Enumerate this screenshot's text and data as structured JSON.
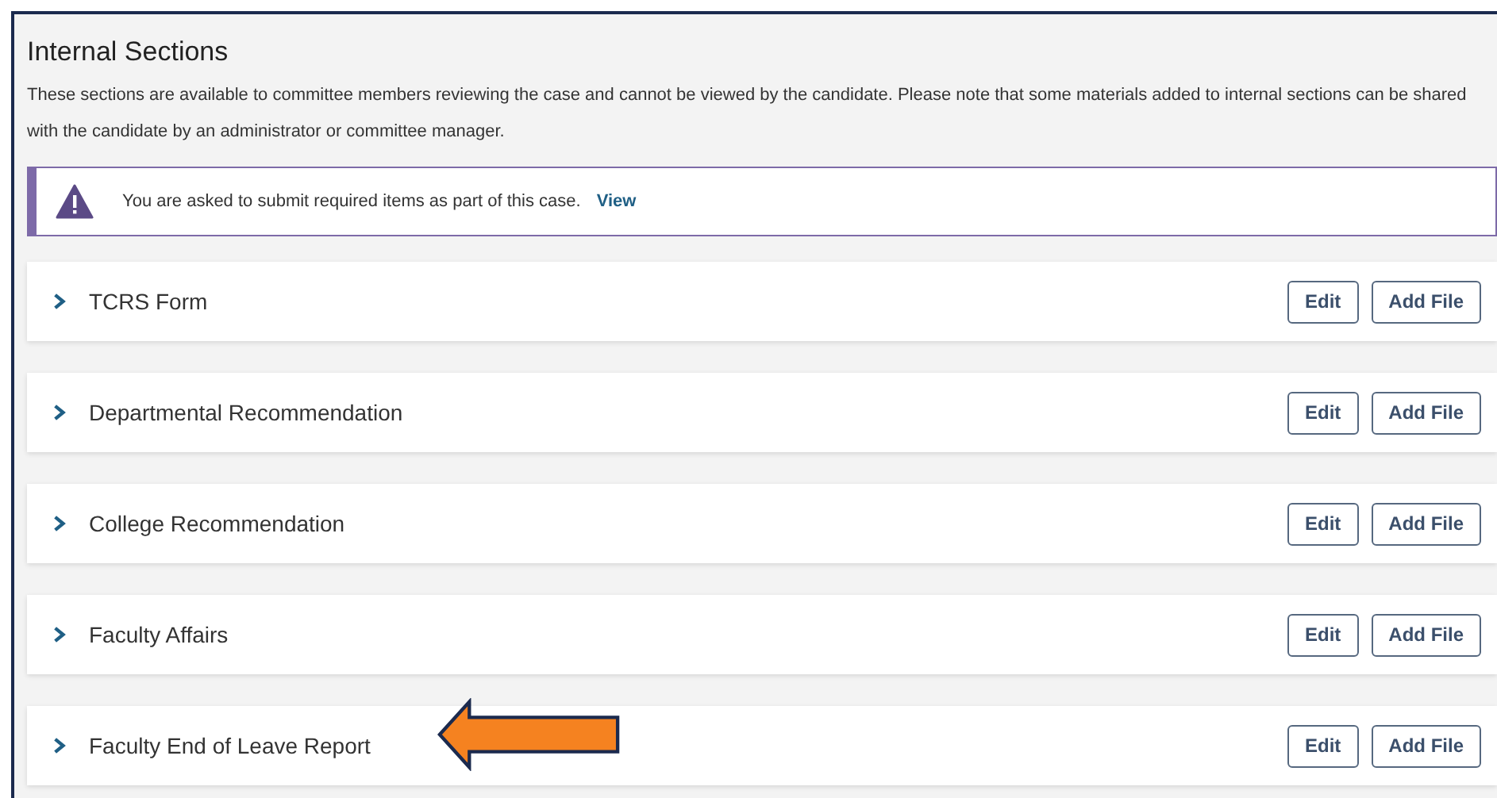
{
  "title": "Internal Sections",
  "description": "These sections are available to committee members reviewing the case and cannot be viewed by the candidate. Please note that some materials added to internal sections can be shared with the candidate by an administrator or committee manager.",
  "alert": {
    "message": "You are asked to submit required items as part of this case.",
    "link": "View"
  },
  "sections": [
    {
      "name": "TCRS Form",
      "expanded": false,
      "buttons": [
        "Edit",
        "Add File"
      ]
    },
    {
      "name": "Departmental Recommendation",
      "expanded": false,
      "buttons": [
        "Edit",
        "Add File"
      ]
    },
    {
      "name": "College Recommendation",
      "expanded": false,
      "buttons": [
        "Edit",
        "Add File"
      ]
    },
    {
      "name": "Faculty Affairs",
      "expanded": false,
      "buttons": [
        "Edit",
        "Add File"
      ]
    },
    {
      "name": "Faculty End of Leave Report",
      "expanded": false,
      "buttons": [
        "Edit",
        "Add File"
      ]
    }
  ]
}
